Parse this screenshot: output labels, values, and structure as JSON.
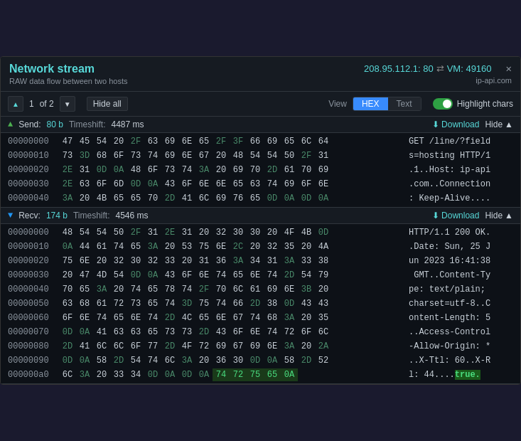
{
  "window": {
    "title": "Network stream",
    "subtitle": "RAW data flow between two hosts",
    "conn": "208.95.112.1: 80",
    "vm": "VM: 49160",
    "domain": "ip-api.com",
    "close_label": "✕"
  },
  "toolbar": {
    "page_current": "1",
    "page_total": "of 2",
    "hide_all_label": "Hide all",
    "view_label": "View",
    "hex_tab": "HEX",
    "text_tab": "Text",
    "highlight_label": "Highlight chars"
  },
  "send": {
    "direction": "Send:",
    "size": "80 b",
    "timeshift_label": "Timeshift:",
    "timeshift_val": "4487 ms",
    "download_label": "Download",
    "hide_label": "Hide",
    "rows": [
      {
        "offset": "00000000",
        "bytes": [
          "47",
          "45",
          "54",
          "20",
          "2F",
          "63",
          "69",
          "6E",
          "65",
          "2F",
          "3F",
          "66",
          "69",
          "65",
          "6C",
          "64"
        ],
        "byte_types": [
          "n",
          "n",
          "n",
          "n",
          "h",
          "n",
          "n",
          "n",
          "n",
          "h",
          "h",
          "n",
          "n",
          "n",
          "n",
          "n"
        ],
        "ascii": "GET /line/?field"
      },
      {
        "offset": "00000010",
        "bytes": [
          "73",
          "3D",
          "68",
          "6F",
          "73",
          "74",
          "69",
          "6E",
          "67",
          "20",
          "48",
          "54",
          "54",
          "50",
          "2F",
          "31"
        ],
        "byte_types": [
          "n",
          "h",
          "n",
          "n",
          "n",
          "n",
          "n",
          "n",
          "n",
          "n",
          "n",
          "n",
          "n",
          "n",
          "h",
          "n"
        ],
        "ascii": "s=hosting HTTP/1"
      },
      {
        "offset": "00000020",
        "bytes": [
          "2E",
          "31",
          "0D",
          "0A",
          "48",
          "6F",
          "73",
          "74",
          "3A",
          "20",
          "69",
          "70",
          "2D",
          "61",
          "70",
          "69"
        ],
        "byte_types": [
          "h",
          "n",
          "h",
          "h",
          "n",
          "n",
          "n",
          "n",
          "h",
          "n",
          "n",
          "n",
          "h",
          "n",
          "n",
          "n"
        ],
        "ascii": ".1..Host: ip-api"
      },
      {
        "offset": "00000030",
        "bytes": [
          "2E",
          "63",
          "6F",
          "6D",
          "0D",
          "0A",
          "43",
          "6F",
          "6E",
          "6E",
          "65",
          "63",
          "74",
          "69",
          "6F",
          "6E"
        ],
        "byte_types": [
          "h",
          "n",
          "n",
          "n",
          "h",
          "h",
          "n",
          "n",
          "n",
          "n",
          "n",
          "n",
          "n",
          "n",
          "n",
          "n"
        ],
        "ascii": ".com..Connection"
      },
      {
        "offset": "00000040",
        "bytes": [
          "3A",
          "20",
          "4B",
          "65",
          "65",
          "70",
          "2D",
          "41",
          "6C",
          "69",
          "76",
          "65",
          "0D",
          "0A",
          "0D",
          "0A"
        ],
        "byte_types": [
          "h",
          "n",
          "n",
          "n",
          "n",
          "n",
          "h",
          "n",
          "n",
          "n",
          "n",
          "n",
          "h",
          "h",
          "h",
          "h"
        ],
        "ascii": ": Keep-Alive...."
      }
    ]
  },
  "recv": {
    "direction": "Recv:",
    "size": "174 b",
    "timeshift_label": "Timeshift:",
    "timeshift_val": "4546 ms",
    "download_label": "Download",
    "hide_label": "Hide",
    "rows": [
      {
        "offset": "00000000",
        "bytes": [
          "48",
          "54",
          "54",
          "50",
          "2F",
          "31",
          "2E",
          "31",
          "20",
          "32",
          "30",
          "30",
          "20",
          "4F",
          "4B",
          "0D"
        ],
        "byte_types": [
          "n",
          "n",
          "n",
          "n",
          "h",
          "n",
          "h",
          "n",
          "n",
          "n",
          "n",
          "n",
          "n",
          "n",
          "n",
          "h"
        ],
        "ascii": "HTTP/1.1 200 OK."
      },
      {
        "offset": "00000010",
        "bytes": [
          "0A",
          "44",
          "61",
          "74",
          "65",
          "3A",
          "20",
          "53",
          "75",
          "6E",
          "2C",
          "20",
          "32",
          "35",
          "20",
          "4A"
        ],
        "byte_types": [
          "h",
          "n",
          "n",
          "n",
          "n",
          "h",
          "n",
          "n",
          "n",
          "n",
          "h",
          "n",
          "n",
          "n",
          "n",
          "n"
        ],
        "ascii": ".Date: Sun, 25 J"
      },
      {
        "offset": "00000020",
        "bytes": [
          "75",
          "6E",
          "20",
          "32",
          "30",
          "32",
          "33",
          "20",
          "31",
          "36",
          "3A",
          "34",
          "31",
          "3A",
          "33",
          "38"
        ],
        "byte_types": [
          "n",
          "n",
          "n",
          "n",
          "n",
          "n",
          "n",
          "n",
          "n",
          "n",
          "h",
          "n",
          "n",
          "h",
          "n",
          "n"
        ],
        "ascii": "un 2023 16:41:38"
      },
      {
        "offset": "00000030",
        "bytes": [
          "20",
          "47",
          "4D",
          "54",
          "0D",
          "0A",
          "43",
          "6F",
          "6E",
          "74",
          "65",
          "6E",
          "74",
          "2D",
          "54",
          "79"
        ],
        "byte_types": [
          "n",
          "n",
          "n",
          "n",
          "h",
          "h",
          "n",
          "n",
          "n",
          "n",
          "n",
          "n",
          "n",
          "h",
          "n",
          "n"
        ],
        "ascii": " GMT..Content-Ty"
      },
      {
        "offset": "00000040",
        "bytes": [
          "70",
          "65",
          "3A",
          "20",
          "74",
          "65",
          "78",
          "74",
          "2F",
          "70",
          "6C",
          "61",
          "69",
          "6E",
          "3B",
          "20"
        ],
        "byte_types": [
          "n",
          "n",
          "h",
          "n",
          "n",
          "n",
          "n",
          "n",
          "h",
          "n",
          "n",
          "n",
          "n",
          "n",
          "h",
          "n"
        ],
        "ascii": "pe: text/plain; "
      },
      {
        "offset": "00000050",
        "bytes": [
          "63",
          "68",
          "61",
          "72",
          "73",
          "65",
          "74",
          "3D",
          "75",
          "74",
          "66",
          "2D",
          "38",
          "0D",
          "43",
          "43"
        ],
        "byte_types": [
          "n",
          "n",
          "n",
          "n",
          "n",
          "n",
          "n",
          "h",
          "n",
          "n",
          "n",
          "h",
          "n",
          "h",
          "n",
          "n"
        ],
        "ascii": "charset=utf-8..C"
      },
      {
        "offset": "00000060",
        "bytes": [
          "6F",
          "6E",
          "74",
          "65",
          "6E",
          "74",
          "2D",
          "4C",
          "65",
          "6E",
          "67",
          "74",
          "68",
          "3A",
          "20",
          "35"
        ],
        "byte_types": [
          "n",
          "n",
          "n",
          "n",
          "n",
          "n",
          "h",
          "n",
          "n",
          "n",
          "n",
          "n",
          "n",
          "h",
          "n",
          "n"
        ],
        "ascii": "ontent-Length: 5"
      },
      {
        "offset": "00000070",
        "bytes": [
          "0D",
          "0A",
          "41",
          "63",
          "63",
          "65",
          "73",
          "73",
          "2D",
          "43",
          "6F",
          "6E",
          "74",
          "72",
          "6F",
          "6C"
        ],
        "byte_types": [
          "h",
          "h",
          "n",
          "n",
          "n",
          "n",
          "n",
          "n",
          "h",
          "n",
          "n",
          "n",
          "n",
          "n",
          "n",
          "n"
        ],
        "ascii": "..Access-Control"
      },
      {
        "offset": "00000080",
        "bytes": [
          "2D",
          "41",
          "6C",
          "6C",
          "6F",
          "77",
          "2D",
          "4F",
          "72",
          "69",
          "67",
          "69",
          "6E",
          "3A",
          "20",
          "2A"
        ],
        "byte_types": [
          "h",
          "n",
          "n",
          "n",
          "n",
          "n",
          "h",
          "n",
          "n",
          "n",
          "n",
          "n",
          "n",
          "h",
          "n",
          "h"
        ],
        "ascii": "-Allow-Origin: *"
      },
      {
        "offset": "00000090",
        "bytes": [
          "0D",
          "0A",
          "58",
          "2D",
          "54",
          "74",
          "6C",
          "3A",
          "20",
          "36",
          "30",
          "0D",
          "0A",
          "58",
          "2D",
          "52"
        ],
        "byte_types": [
          "h",
          "h",
          "n",
          "h",
          "n",
          "n",
          "n",
          "h",
          "n",
          "n",
          "n",
          "h",
          "h",
          "n",
          "h",
          "n"
        ],
        "ascii": "..X-Ttl: 60..X-R"
      },
      {
        "offset": "000000a0",
        "bytes": [
          "6C",
          "3A",
          "20",
          "33",
          "34",
          "0D",
          "0A",
          "0D",
          "0A",
          "74",
          "72",
          "75",
          "65",
          "0A"
        ],
        "byte_types": [
          "n",
          "h",
          "n",
          "n",
          "n",
          "h",
          "h",
          "h",
          "h",
          "sel",
          "sel",
          "sel",
          "sel",
          "sel"
        ],
        "ascii": "l: 44....true."
      }
    ]
  },
  "colors": {
    "highlight_hex": "#4ade80",
    "normal_hex": "#c9d1d9",
    "faded_hex": "#4a6a5a",
    "offset_color": "#8b949e",
    "selected_bg": "#1a6b2a",
    "selected_text": "#4ade80"
  }
}
